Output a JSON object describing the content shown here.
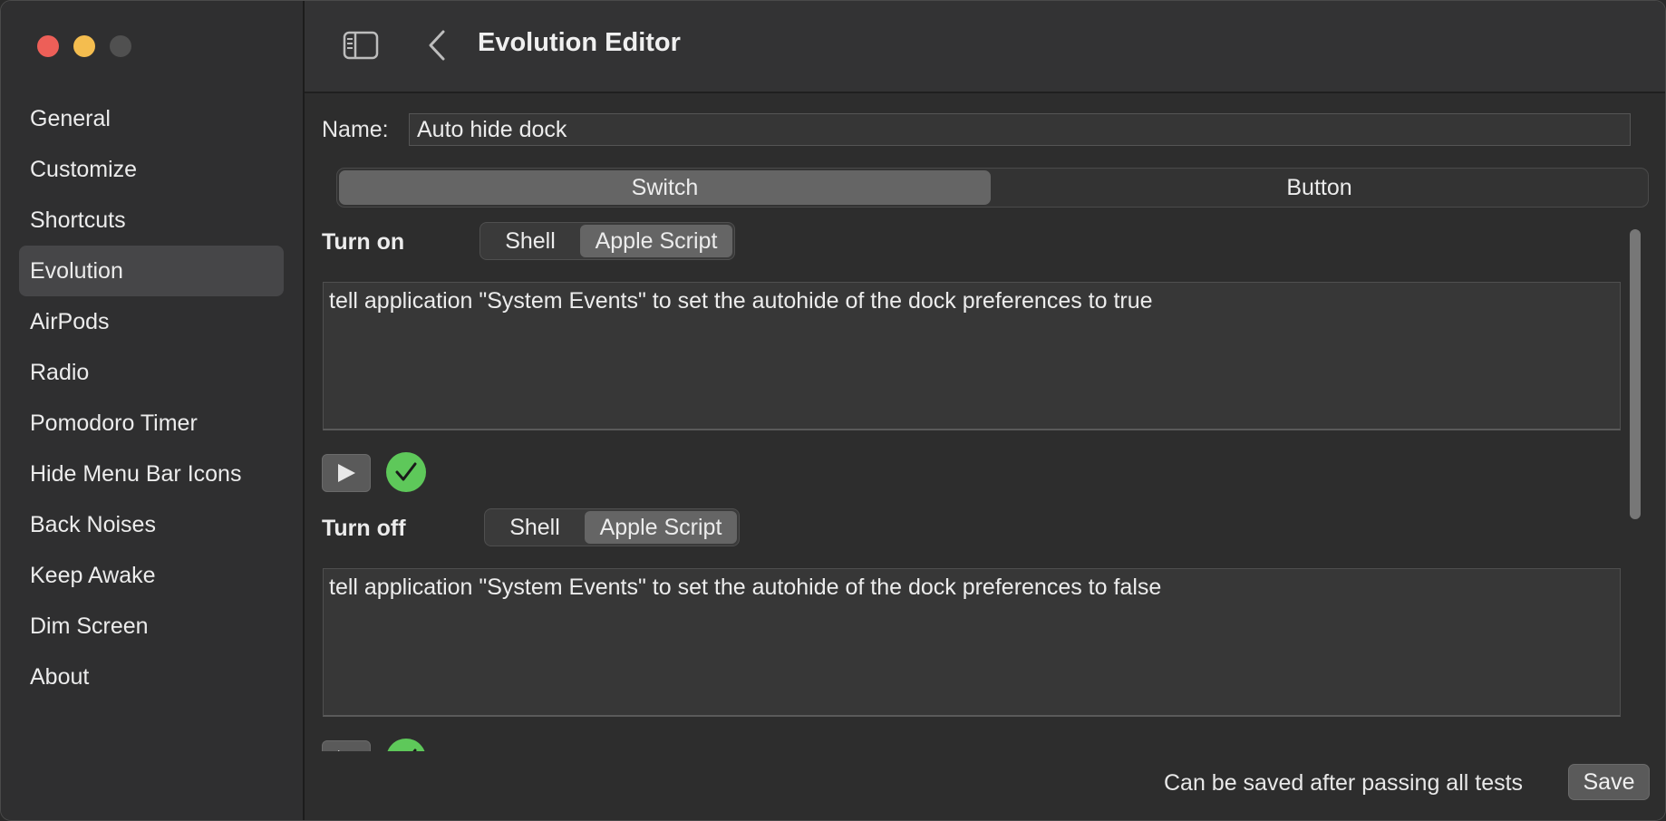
{
  "window": {
    "controls": [
      "close",
      "minimize",
      "zoom"
    ]
  },
  "sidebar": {
    "items": [
      {
        "label": "General"
      },
      {
        "label": "Customize"
      },
      {
        "label": "Shortcuts"
      },
      {
        "label": "Evolution",
        "active": true
      },
      {
        "label": "AirPods"
      },
      {
        "label": "Radio"
      },
      {
        "label": "Pomodoro Timer"
      },
      {
        "label": "Hide Menu Bar Icons"
      },
      {
        "label": "Back Noises"
      },
      {
        "label": "Keep Awake"
      },
      {
        "label": "Dim Screen"
      },
      {
        "label": "About"
      }
    ]
  },
  "toolbar": {
    "title": "Evolution Editor",
    "icons": [
      "sidebar-toggle-icon",
      "back-chevron-icon"
    ]
  },
  "form": {
    "name_label": "Name:",
    "name_value": "Auto hide dock",
    "type_segments": [
      "Switch",
      "Button"
    ],
    "type_selected": "Switch"
  },
  "turn_on": {
    "label": "Turn on",
    "lang_options": [
      "Shell",
      "Apple Script"
    ],
    "lang_selected": "Apple Script",
    "script": "tell application \"System Events\" to set the autohide of the dock preferences to true",
    "test_passed": true
  },
  "turn_off": {
    "label": "Turn off",
    "lang_options": [
      "Shell",
      "Apple Script"
    ],
    "lang_selected": "Apple Script",
    "script": "tell application \"System Events\" to set the autohide of the dock preferences to false",
    "test_passed": true
  },
  "footer": {
    "status": "Can be saved after passing all tests",
    "save_label": "Save"
  },
  "colors": {
    "accent_green": "#5ec85a",
    "close": "#ed5f58",
    "minimize": "#f4bd4f"
  }
}
